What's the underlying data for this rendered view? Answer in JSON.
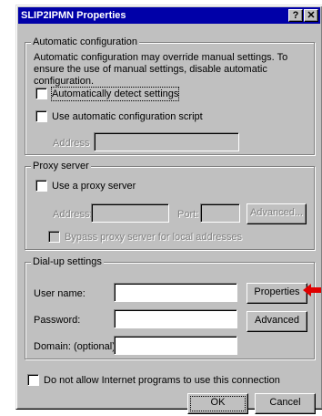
{
  "window": {
    "title": "SLIP2IPMN Properties",
    "help_glyph": "?",
    "close_glyph": "✕"
  },
  "auto_config": {
    "legend": "Automatic configuration",
    "description": "Automatic configuration may override manual settings.  To ensure the use of manual settings, disable automatic configuration.",
    "auto_detect_label": "Automatically detect settings",
    "auto_detect_checked": false,
    "script_label": "Use automatic configuration script",
    "script_checked": false,
    "address_label": "Address",
    "address_value": ""
  },
  "proxy": {
    "legend": "Proxy server",
    "use_proxy_label": "Use a proxy server",
    "use_proxy_checked": false,
    "address_label": "Address:",
    "address_value": "",
    "port_label": "Port:",
    "port_value": "",
    "advanced_label": "Advanced...",
    "bypass_label": "Bypass proxy server for local addresses",
    "bypass_checked": false
  },
  "dialup": {
    "legend": "Dial-up settings",
    "username_label": "User name:",
    "username_value": "",
    "password_label": "Password:",
    "password_value": "",
    "domain_label": "Domain: (optional)",
    "domain_value": "",
    "properties_label": "Properties",
    "advanced_label": "Advanced"
  },
  "footer": {
    "no_internet_label": "Do not allow Internet programs to use this connection",
    "no_internet_checked": false,
    "ok_label": "OK",
    "cancel_label": "Cancel"
  },
  "colors": {
    "title_bar": "#0000a8",
    "dialog_face": "#c0c0c0",
    "annotation_arrow": "#e00000"
  },
  "annotation": {
    "icon": "red-arrow-icon"
  }
}
